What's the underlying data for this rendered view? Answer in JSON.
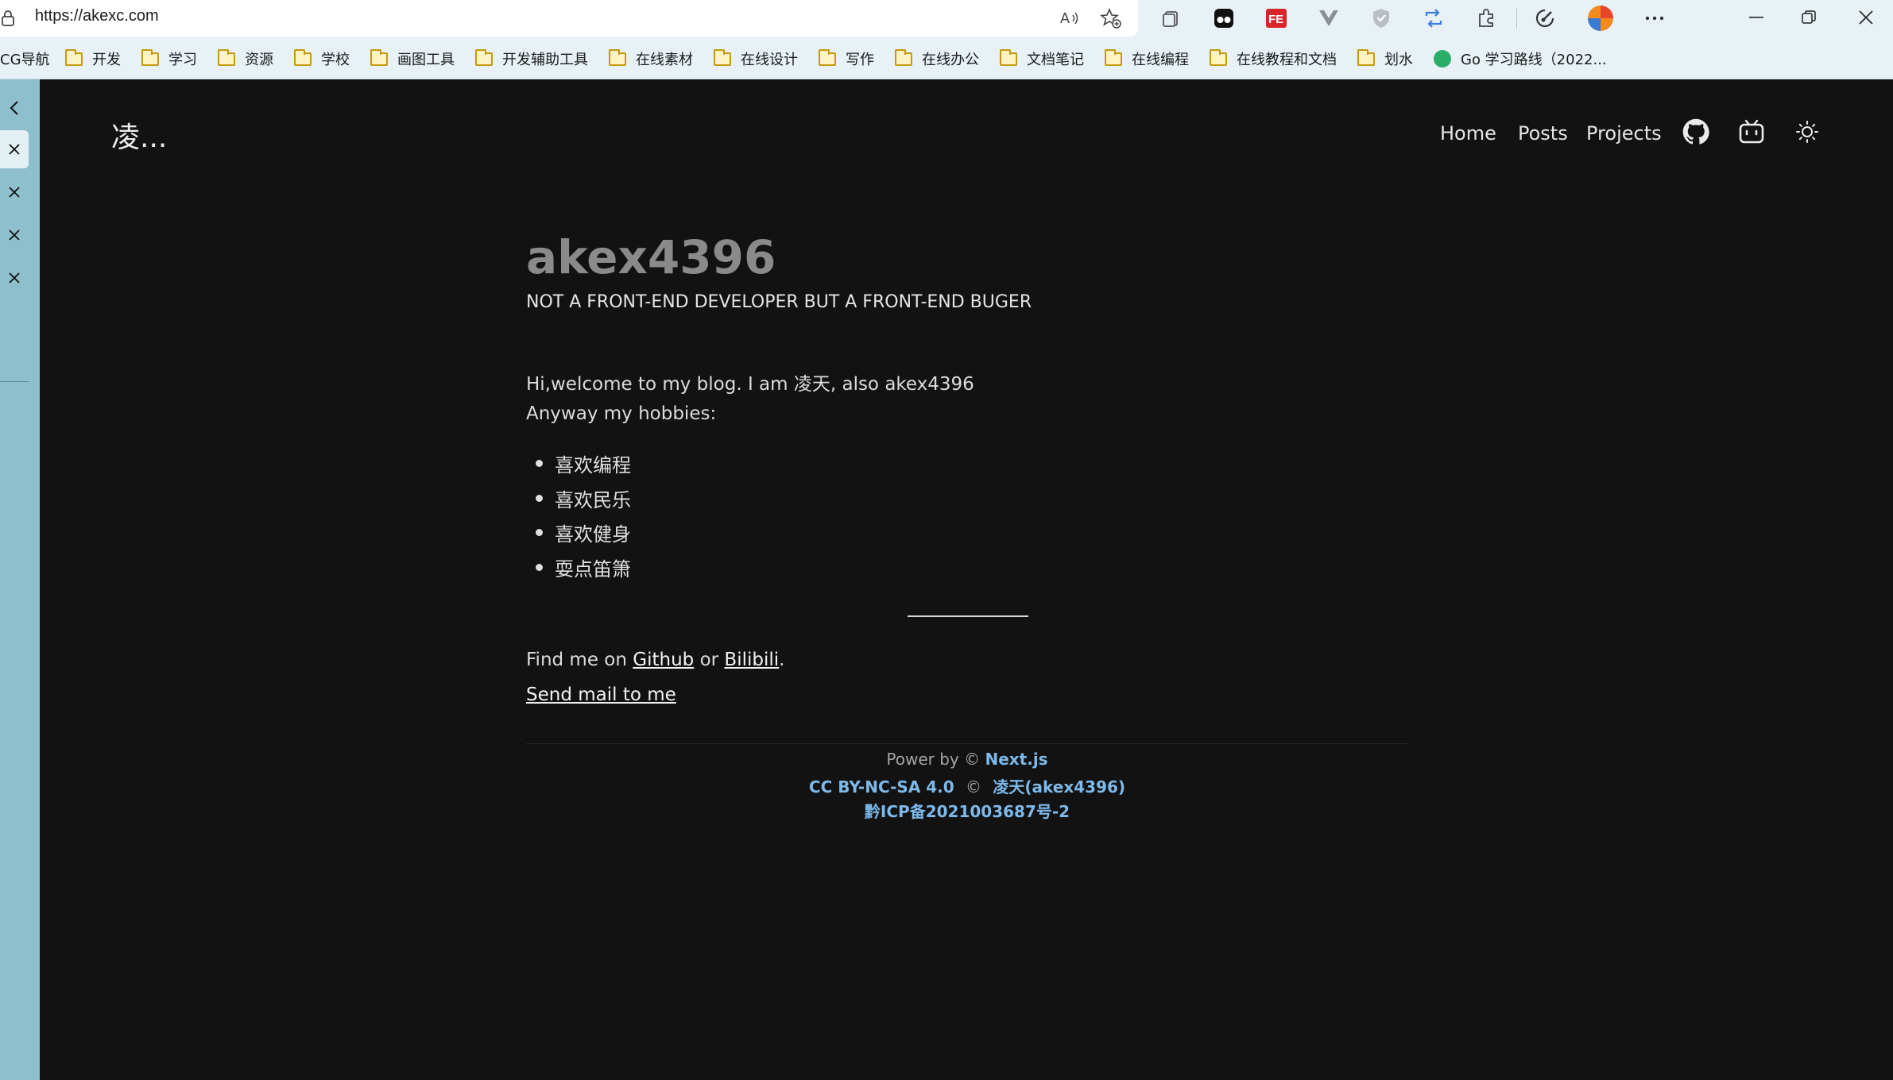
{
  "browser": {
    "url": "https://akexc.com",
    "bookmarks": [
      {
        "label": "CG导航",
        "type": "text"
      },
      {
        "label": "开发",
        "type": "folder"
      },
      {
        "label": "学习",
        "type": "folder"
      },
      {
        "label": "资源",
        "type": "folder"
      },
      {
        "label": "学校",
        "type": "folder"
      },
      {
        "label": "画图工具",
        "type": "folder"
      },
      {
        "label": "开发辅助工具",
        "type": "folder"
      },
      {
        "label": "在线素材",
        "type": "folder"
      },
      {
        "label": "在线设计",
        "type": "folder"
      },
      {
        "label": "写作",
        "type": "folder"
      },
      {
        "label": "在线办公",
        "type": "folder"
      },
      {
        "label": "文档笔记",
        "type": "folder"
      },
      {
        "label": "在线编程",
        "type": "folder"
      },
      {
        "label": "在线教程和文档",
        "type": "folder"
      },
      {
        "label": "划水",
        "type": "folder"
      },
      {
        "label": "Go 学习路线（2022...",
        "type": "wechat"
      }
    ]
  },
  "site": {
    "brand": "凌...",
    "nav": {
      "home": "Home",
      "posts": "Posts",
      "projects": "Projects"
    }
  },
  "content": {
    "title": "akex4396",
    "subtitle": "NOT A FRONT-END DEVELOPER BUT A FRONT-END BUGER",
    "intro": "Hi,welcome to my blog. I am 凌天, also akex4396",
    "hobbies_intro": "Anyway my hobbies:",
    "hobbies": [
      "喜欢编程",
      "喜欢民乐",
      "喜欢健身",
      "耍点笛箫"
    ],
    "find_prefix": "Find me on ",
    "github": "Github",
    "or_text": " or ",
    "bilibili": "Bilibili",
    "period": ".",
    "mail": "Send mail to me"
  },
  "footer": {
    "power_prefix": "Power by © ",
    "power_link": "Next.js",
    "license": "CC BY-NC-SA 4.0",
    "copy_symbol": "©",
    "author": "凌天(akex4396)",
    "icp": "黔ICP备2021003687号-2"
  },
  "colors": {
    "page_bg": "#121212",
    "accent": "#7db9ea",
    "sidebar": "#8dc0cc"
  }
}
